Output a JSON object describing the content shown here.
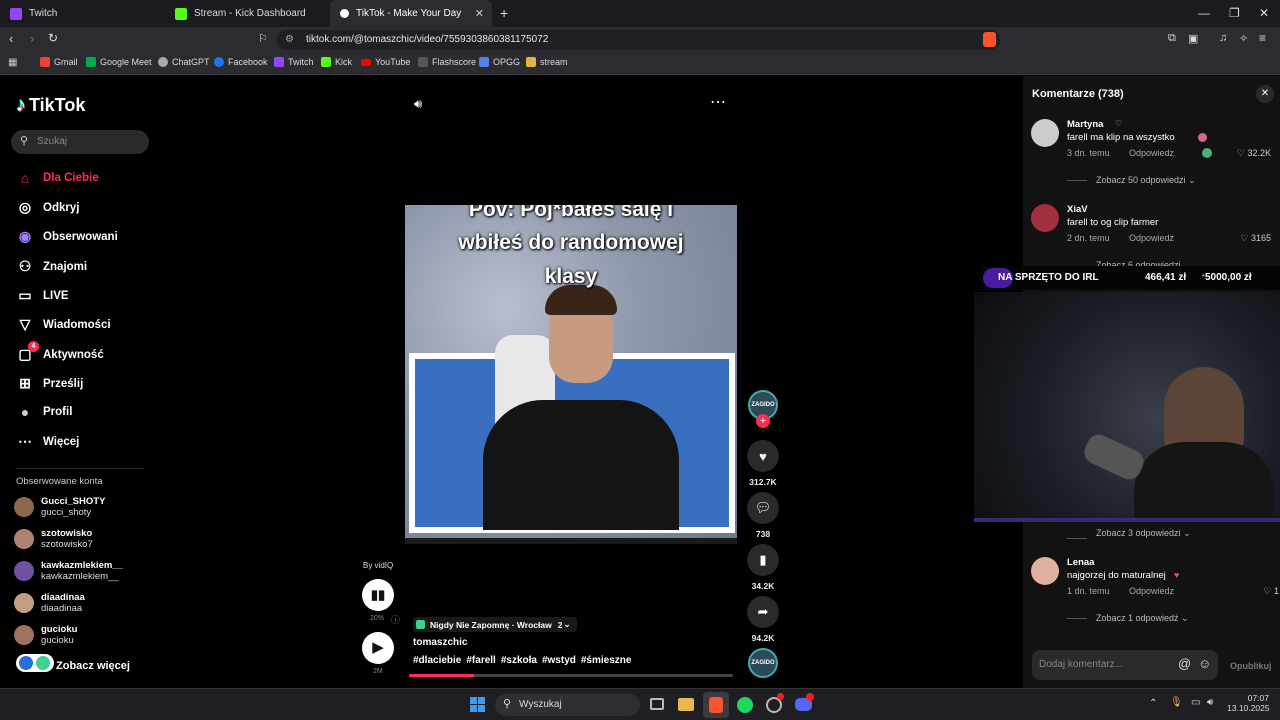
{
  "tabs": [
    {
      "label": "Twitch",
      "color": "#9146ff"
    },
    {
      "label": "Stream - Kick Dashboard",
      "color": "#53fc18"
    },
    {
      "label": "TikTok - Make Your Day",
      "color": "#ffffff"
    }
  ],
  "url": "tiktok.com/@tomaszchic/video/7559303860381175072",
  "bookmarks": [
    {
      "label": "Gmail",
      "color": "#ea4335"
    },
    {
      "label": "Google Meet",
      "color": "#00ac47"
    },
    {
      "label": "ChatGPT",
      "color": "#aaaaaa"
    },
    {
      "label": "Facebook",
      "color": "#1877f2"
    },
    {
      "label": "Twitch",
      "color": "#9146ff"
    },
    {
      "label": "Kick",
      "color": "#53fc18"
    },
    {
      "label": "YouTube",
      "color": "#ff0000"
    },
    {
      "label": "Flashscore",
      "color": "#333333"
    },
    {
      "label": "OPGG",
      "color": "#5383e8"
    },
    {
      "label": "stream",
      "color": "#e3b341"
    }
  ],
  "tiktok": {
    "logo": "TikTok",
    "search_placeholder": "Szukaj",
    "nav": [
      {
        "label": "Dla Ciebie",
        "icon": "home-icon",
        "glyph": "⌂",
        "active": true
      },
      {
        "label": "Odkryj",
        "icon": "compass-icon",
        "glyph": "◎"
      },
      {
        "label": "Obserwowani",
        "icon": "following-icon",
        "glyph": "◉"
      },
      {
        "label": "Znajomi",
        "icon": "friends-icon",
        "glyph": "⚇"
      },
      {
        "label": "LIVE",
        "icon": "live-icon",
        "glyph": "▭"
      },
      {
        "label": "Wiadomości",
        "icon": "messages-icon",
        "glyph": "▽"
      },
      {
        "label": "Aktywność",
        "icon": "activity-icon",
        "glyph": "▢",
        "badge": "4"
      },
      {
        "label": "Prześlij",
        "icon": "upload-icon",
        "glyph": "⊞"
      },
      {
        "label": "Profil",
        "icon": "profile-icon",
        "glyph": "●"
      },
      {
        "label": "Więcej",
        "icon": "more-icon",
        "glyph": "⋯"
      }
    ],
    "followed_header": "Obserwowane konta",
    "followed": [
      {
        "name": "Gucci_SHOTY",
        "handle": "gucci_shoty",
        "color": "#8a6a4a"
      },
      {
        "name": "szotowisko",
        "handle": "szotowisko7",
        "color": "#b08070"
      },
      {
        "name": "kawkazmlekiem__",
        "handle": "kawkazmlekiem__",
        "color": "#7050a0"
      },
      {
        "name": "diaadinaa",
        "handle": "diaadinaa",
        "color": "#c0a080"
      },
      {
        "name": "gucioku",
        "handle": "gucioku",
        "color": "#a07060"
      }
    ],
    "see_more": "Zobacz więcej"
  },
  "video": {
    "caption_lines": [
      "Pov: Poj*bałeś salę i",
      "wbiłeś do randomowej",
      "klasy"
    ],
    "music": "Nigdy Nie Zapomnę · Wrocław",
    "music_count": "2",
    "author": "tomaszchic",
    "hashtags": [
      "#dlaciebie",
      "#farell",
      "#szkoła",
      "#wstyd",
      "#śmieszne"
    ],
    "likes": "312.7K",
    "comments": "738",
    "saves": "34.2K",
    "shares": "94.2K",
    "progress": 0.2,
    "by_label": "By vidIQ",
    "pct_label": "20%",
    "duration_label": "2M",
    "avatar_text": "ZAGIDO"
  },
  "comments_panel": {
    "title": "Komentarze (738)",
    "items": [
      {
        "user": "Martyna",
        "text": "farell ma klip na wszystko",
        "time": "3 dn. temu",
        "reply": "Odpowiedz",
        "likes": "32.2K",
        "color": "#cccccc"
      },
      {
        "user": "XiaV",
        "text": "farell to og clip farmer",
        "time": "2 dn. temu",
        "reply": "Odpowiedz",
        "likes": "3165",
        "color": "#a03040"
      },
      {
        "user": "Lenaa",
        "text": "najgorzej do maturalnej",
        "time": "1 dn. temu",
        "reply": "Odpowiedz",
        "likes": "1",
        "color": "#e0b0a0"
      }
    ],
    "see_replies": [
      "Zobacz 50 odpowiedzi",
      "Zobacz 6 odpowiedzi",
      "Zobacz 3 odpowiedzi",
      "Zobacz 1 odpowiedź"
    ],
    "input_placeholder": "Dodaj komentarz...",
    "publish": "Opublikuj"
  },
  "overlay": {
    "label": "NA SPRZĘTO DO IRL",
    "amount": "466,41 zł",
    "goal": "5000,00 zł"
  },
  "taskbar": {
    "search": "Wyszukaj",
    "time": "07:07",
    "date": "13.10.2025"
  }
}
